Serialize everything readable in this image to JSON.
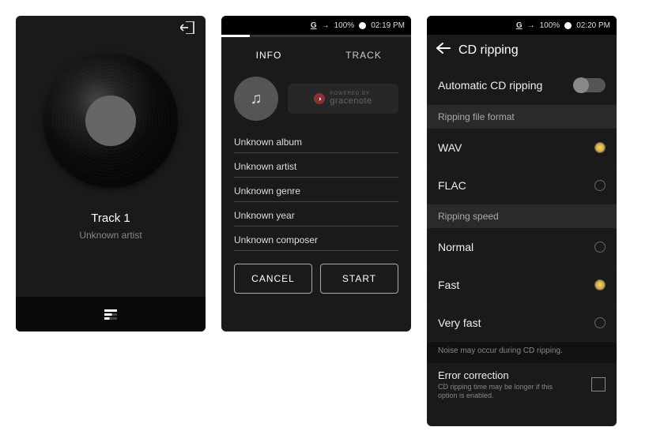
{
  "statusbar": {
    "g": "G",
    "arrow": "→",
    "battery": "100%",
    "time1": "02:19 PM",
    "time2": "02:20 PM"
  },
  "player": {
    "track_title": "Track 1",
    "artist": "Unknown artist"
  },
  "tabs": {
    "info": "INFO",
    "track": "TRACK"
  },
  "gracenote": {
    "prefix": "POWERED BY",
    "name": "gracenote"
  },
  "fields": {
    "album": "Unknown album",
    "artist": "Unknown artist",
    "genre": "Unknown genre",
    "year": "Unknown year",
    "composer": "Unknown composer"
  },
  "buttons": {
    "cancel": "CANCEL",
    "start": "START"
  },
  "ripping": {
    "title": "CD ripping",
    "auto": "Automatic CD ripping",
    "format_label": "Ripping file format",
    "wav": "WAV",
    "flac": "FLAC",
    "speed_label": "Ripping speed",
    "normal": "Normal",
    "fast": "Fast",
    "veryfast": "Very fast",
    "noise_hint": "Noise may occur during CD ripping.",
    "error_correction": "Error correction",
    "error_sub": "CD ripping time may be longer if this option is enabled."
  }
}
